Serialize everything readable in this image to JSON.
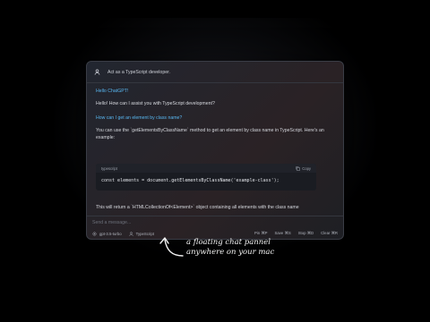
{
  "system_prompt": {
    "text": "Act as a TypeScript developer."
  },
  "messages": [
    {
      "role": "user",
      "text": "Hello ChatGPT!"
    },
    {
      "role": "assistant",
      "text": "Hello! How can I assist you with TypeScript development?"
    },
    {
      "role": "user",
      "text": "How can I get an element by class name?"
    },
    {
      "role": "assistant",
      "text": "You can use the `getElementsByClassName` method to get an element by class name in TypeScript. Here's an example:"
    }
  ],
  "code": {
    "language": "typescript",
    "copy_label": "Copy",
    "line": "const elements = document.getElementsByClassName('example-class');"
  },
  "trailing_text": "This will return a `HTMLCollectionOf<Element>` object containing all elements with the class name",
  "input": {
    "placeholder": "Send a message...",
    "value": ""
  },
  "status": {
    "model": "gpt-3.5-turbo",
    "persona": "TypeScript",
    "shortcuts": {
      "pin": "Pin ⌘P",
      "save": "Save ⌘S",
      "stop": "Stop ⌘D",
      "clear": "Clear ⌘R"
    }
  },
  "annotation": {
    "line1": "a floating chat pannel",
    "line2": "anywhere on your mac"
  },
  "colors": {
    "accent_blue": "#58b6f0",
    "panel_bg": "#24262d",
    "text": "#d9dbe1"
  }
}
